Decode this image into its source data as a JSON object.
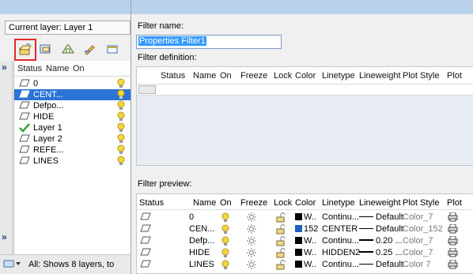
{
  "layer_palette": {
    "current_layer": "Current layer: Layer 1",
    "header": {
      "status": "Status",
      "name": "Name",
      "on": "On"
    },
    "layers": [
      {
        "name": "0",
        "icon": "layer-sheet-icon",
        "selected": false
      },
      {
        "name": "CENT...",
        "icon": "layer-sheet-icon",
        "selected": true
      },
      {
        "name": "Defpo...",
        "icon": "layer-sheet-icon",
        "selected": false
      },
      {
        "name": "HIDE",
        "icon": "layer-sheet-icon",
        "selected": false
      },
      {
        "name": "Layer 1",
        "icon": "checkmark-icon",
        "selected": false
      },
      {
        "name": "Layer 2",
        "icon": "layer-sheet-icon",
        "selected": false
      },
      {
        "name": "REFE...",
        "icon": "layer-sheet-icon",
        "selected": false
      },
      {
        "name": "LINES",
        "icon": "layer-sheet-icon",
        "selected": false
      }
    ],
    "collapse_top": "»",
    "collapse_bottom": "»",
    "status_text": "All: Shows 8 layers, to"
  },
  "filter_dialog": {
    "filter_name_label": "Filter name:",
    "filter_name_value": "Properties Filter1",
    "filter_definition_label": "Filter definition:",
    "definition_columns": [
      "Status",
      "Name",
      "On",
      "Freeze",
      "Lock",
      "Color",
      "Linetype",
      "Lineweight",
      "Plot Style",
      "Plot"
    ],
    "filter_preview_label": "Filter preview:",
    "preview_columns": [
      "Status",
      "Name",
      "On",
      "Freeze",
      "Lock",
      "Color",
      "Linetype",
      "Lineweight",
      "Plot Style",
      "Plot"
    ],
    "preview_rows": [
      {
        "name": "0",
        "color_swatch": "#000000",
        "color": "W..",
        "linetype": "Continu...",
        "lineweight": "Default",
        "plot_style": "Color_7"
      },
      {
        "name": "CEN...",
        "color_swatch": "#1f5fbf",
        "color": "152",
        "linetype": "CENTER",
        "lineweight": "Default",
        "plot_style": "Color_152"
      },
      {
        "name": "Defp...",
        "color_swatch": "#000000",
        "color": "W..",
        "linetype": "Continu...",
        "lineweight": "0.20 ...",
        "plot_style": "Color_7"
      },
      {
        "name": "HIDE",
        "color_swatch": "#000000",
        "color": "W..",
        "linetype": "HIDDEN2",
        "lineweight": "0.25 ...",
        "plot_style": "Color_7"
      },
      {
        "name": "LINES",
        "color_swatch": "#000000",
        "color": "W..",
        "linetype": "Continu...",
        "lineweight": "Default",
        "plot_style": "Color 7"
      }
    ]
  },
  "colors": {
    "selection": "#2c74d6",
    "highlight_box": "#e12a2a",
    "bulb": "#f6d640"
  }
}
